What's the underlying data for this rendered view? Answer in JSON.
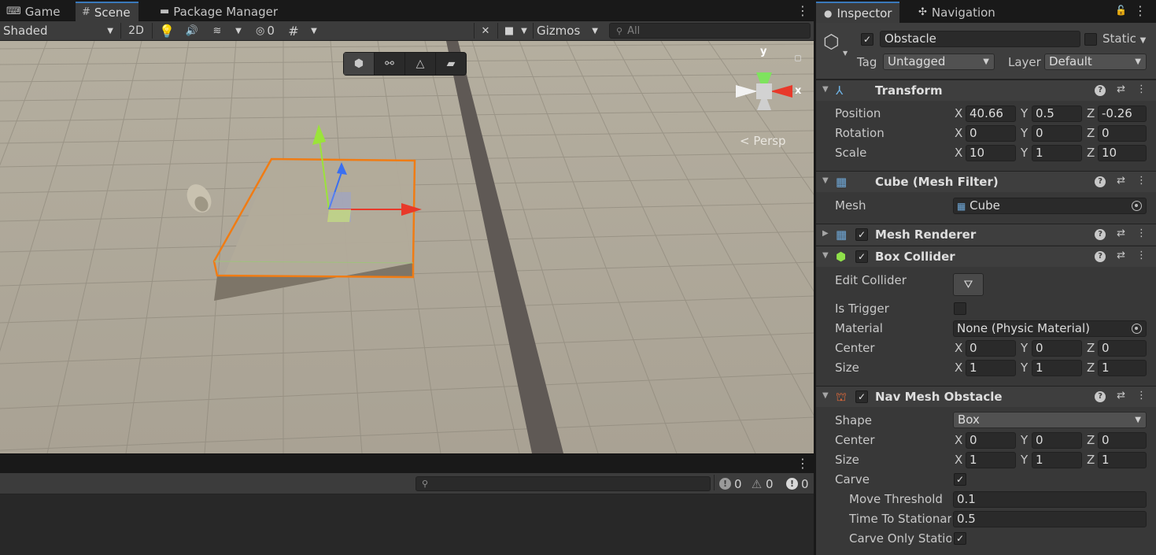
{
  "scene_tabs": [
    {
      "label": "Game",
      "icon": "gamepad-icon"
    },
    {
      "label": "Scene",
      "icon": "grid-icon"
    },
    {
      "label": "Package Manager",
      "icon": "package-icon"
    }
  ],
  "scene_toolbar": {
    "shading_mode": "Shaded",
    "mode_2d": "2D",
    "hidden_count": "0",
    "gizmos_label": "Gizmos",
    "search_placeholder": "All"
  },
  "viewport": {
    "projection_label": "< Persp",
    "gizmo_axes": {
      "y": "y",
      "x": "x"
    }
  },
  "console": {
    "error_count": "0",
    "warning_count": "0",
    "info_count": "0"
  },
  "inspector_tabs": [
    {
      "label": "Inspector",
      "icon": "info-icon"
    },
    {
      "label": "Navigation",
      "icon": "navigation-icon"
    }
  ],
  "gameobject": {
    "active": true,
    "name": "Obstacle",
    "static_label": "Static",
    "tag_label": "Tag",
    "tag_value": "Untagged",
    "layer_label": "Layer",
    "layer_value": "Default"
  },
  "transform": {
    "title": "Transform",
    "position_label": "Position",
    "rotation_label": "Rotation",
    "scale_label": "Scale",
    "position": {
      "x": "40.66",
      "y": "0.5",
      "z": "-0.26"
    },
    "rotation": {
      "x": "0",
      "y": "0",
      "z": "0"
    },
    "scale": {
      "x": "10",
      "y": "1",
      "z": "10"
    }
  },
  "mesh_filter": {
    "title": "Cube (Mesh Filter)",
    "mesh_label": "Mesh",
    "mesh_value": "Cube"
  },
  "mesh_renderer": {
    "title": "Mesh Renderer",
    "enabled": true
  },
  "box_collider": {
    "title": "Box Collider",
    "enabled": true,
    "edit_label": "Edit Collider",
    "trigger_label": "Is Trigger",
    "is_trigger": false,
    "material_label": "Material",
    "material_value": "None (Physic Material)",
    "center_label": "Center",
    "size_label": "Size",
    "center": {
      "x": "0",
      "y": "0",
      "z": "0"
    },
    "size": {
      "x": "1",
      "y": "1",
      "z": "1"
    }
  },
  "nav_mesh_obstacle": {
    "title": "Nav Mesh Obstacle",
    "enabled": true,
    "shape_label": "Shape",
    "shape_value": "Box",
    "center_label": "Center",
    "size_label": "Size",
    "center": {
      "x": "0",
      "y": "0",
      "z": "0"
    },
    "size": {
      "x": "1",
      "y": "1",
      "z": "1"
    },
    "carve_label": "Carve",
    "carve": true,
    "move_threshold_label": "Move Threshold",
    "move_threshold": "0.1",
    "time_to_stationary_label": "Time To Stationar",
    "time_to_stationary": "0.5",
    "carve_only_stationary_label": "Carve Only Statio",
    "carve_only_stationary": true
  },
  "axis_letters": {
    "x": "X",
    "y": "Y",
    "z": "Z"
  },
  "colors": {
    "selection_outline": "#f07c14",
    "tab_accent": "#3a79bb",
    "gizmo_x": "#e8392a",
    "gizmo_y": "#9be33a",
    "gizmo_z": "#3a6ff0"
  }
}
